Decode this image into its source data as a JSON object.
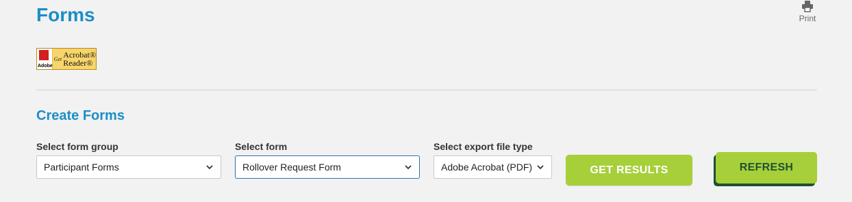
{
  "page": {
    "title": "Forms"
  },
  "print": {
    "label": "Print",
    "icon": "printer-icon"
  },
  "acrobat_badge": {
    "adobe": "Adobe",
    "get": "Get",
    "line1": "Acrobat®",
    "line2": "Reader®"
  },
  "section": {
    "title": "Create Forms"
  },
  "form_group": {
    "label": "Select form group",
    "value": "Participant Forms"
  },
  "form": {
    "label": "Select form",
    "value": "Rollover Request Form"
  },
  "export_type": {
    "label": "Select export file type",
    "value": "Adobe Acrobat (PDF)"
  },
  "buttons": {
    "get_results": "GET RESULTS",
    "refresh": "REFRESH"
  },
  "colors": {
    "accent_blue": "#1b8ec8",
    "button_green": "#a7cf3a",
    "dark_green": "#1d5130"
  }
}
